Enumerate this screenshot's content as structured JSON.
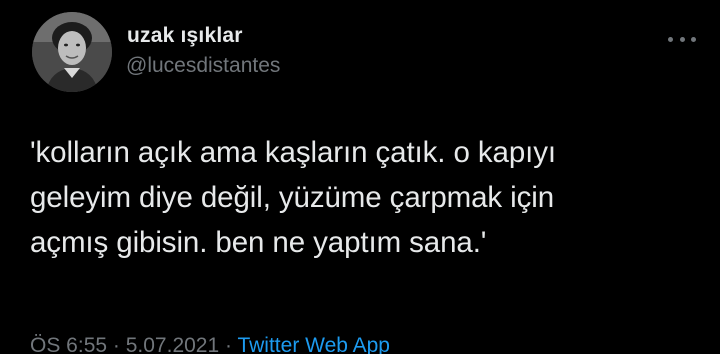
{
  "author": {
    "display_name": "uzak ışıklar",
    "handle": "@lucesdistantes",
    "avatar_icon": "user-avatar-photo"
  },
  "more_icon": "more-horizontal-icon",
  "tweet": {
    "lines": [
      "'kolların açık ama kaşların çatık. o kapıyı",
      "geleyim diye değil, yüzüme çarpmak için",
      "açmış gibisin. ben ne yaptım sana.'"
    ]
  },
  "meta": {
    "time": "ÖS 6:55",
    "separator_1": " · ",
    "date": "5.07.2021",
    "separator_2": " · ",
    "source": "Twitter Web App"
  },
  "colors": {
    "background": "#000000",
    "text": "#e7e9ea",
    "secondary": "#71767b",
    "link": "#1d9bf0"
  }
}
